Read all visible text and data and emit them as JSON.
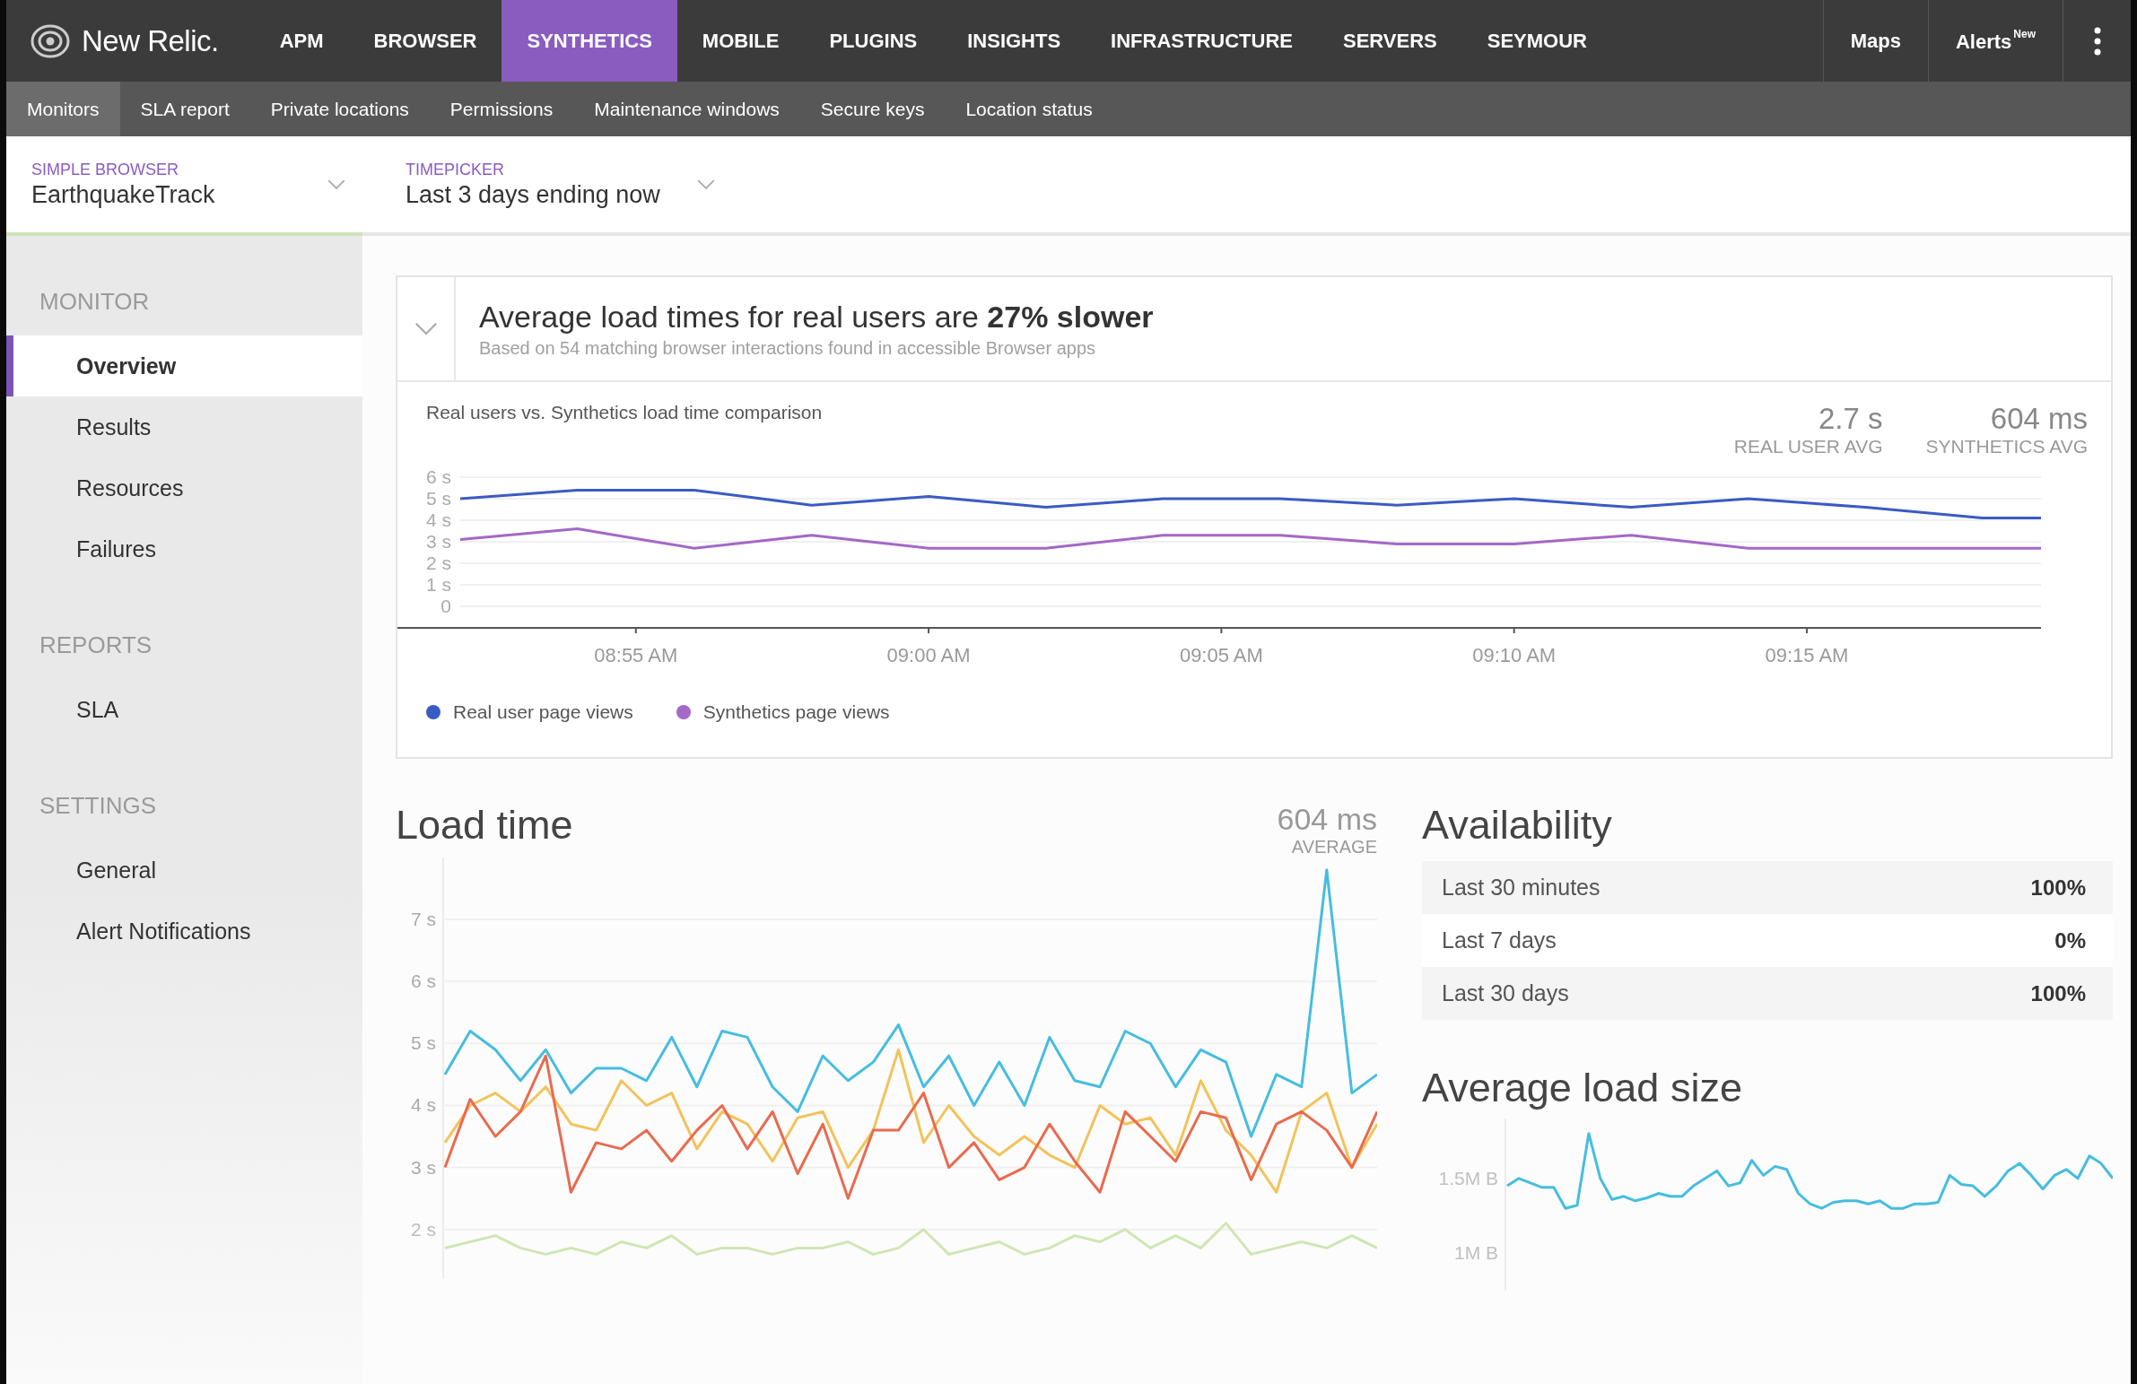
{
  "brand": "New Relic.",
  "nav": [
    {
      "label": "APM",
      "selected": false
    },
    {
      "label": "BROWSER",
      "selected": false
    },
    {
      "label": "SYNTHETICS",
      "selected": true
    },
    {
      "label": "MOBILE",
      "selected": false
    },
    {
      "label": "PLUGINS",
      "selected": false
    },
    {
      "label": "INSIGHTS",
      "selected": false
    },
    {
      "label": "INFRASTRUCTURE",
      "selected": false
    },
    {
      "label": "SERVERS",
      "selected": false
    },
    {
      "label": "SEYMOUR",
      "selected": false
    }
  ],
  "nav_right": [
    {
      "label": "Maps"
    },
    {
      "label": "Alerts",
      "badge": "New"
    }
  ],
  "subnav": [
    {
      "label": "Monitors",
      "selected": true
    },
    {
      "label": "SLA report",
      "selected": false
    },
    {
      "label": "Private locations",
      "selected": false
    },
    {
      "label": "Permissions",
      "selected": false
    },
    {
      "label": "Maintenance windows",
      "selected": false
    },
    {
      "label": "Secure keys",
      "selected": false
    },
    {
      "label": "Location status",
      "selected": false
    }
  ],
  "monitor_picker": {
    "label": "SIMPLE BROWSER",
    "value": "EarthquakeTrack"
  },
  "timepicker": {
    "label": "TIMEPICKER",
    "value": "Last 3 days ending now"
  },
  "sidebar": [
    {
      "heading": "MONITOR",
      "items": [
        {
          "label": "Overview",
          "selected": true
        },
        {
          "label": "Results",
          "selected": false
        },
        {
          "label": "Resources",
          "selected": false
        },
        {
          "label": "Failures",
          "selected": false
        }
      ]
    },
    {
      "heading": "REPORTS",
      "items": [
        {
          "label": "SLA",
          "selected": false
        }
      ]
    },
    {
      "heading": "SETTINGS",
      "items": [
        {
          "label": "General",
          "selected": false
        },
        {
          "label": "Alert Notifications",
          "selected": false
        }
      ]
    }
  ],
  "insight": {
    "headline": "Average load times for real users are **27% slower**",
    "subtext": "Based on 54 matching browser interactions found in accessible Browser apps"
  },
  "comparison": {
    "title": "Real users vs. Synthetics load time comparison",
    "stats": [
      {
        "value": "2.7 s",
        "label": "REAL USER AVG"
      },
      {
        "value": "604 ms",
        "label": "SYNTHETICS AVG"
      }
    ],
    "chart_data": {
      "type": "line",
      "grid": true,
      "ylim": [
        0,
        6
      ],
      "categories": [
        null,
        null,
        null,
        "08:55 AM",
        null,
        null,
        null,
        null,
        "09:00 AM",
        null,
        null,
        null,
        null,
        "09:05 AM",
        null,
        null,
        null,
        null,
        "09:10 AM",
        null,
        null,
        null,
        null,
        "09:15 AM",
        null,
        null,
        null,
        null
      ],
      "yticks": [
        {
          "value": 0,
          "label": "0"
        },
        {
          "value": 1,
          "label": "1 s"
        },
        {
          "value": 2,
          "label": "2 s"
        },
        {
          "value": 3,
          "label": "3 s"
        },
        {
          "value": 4,
          "label": "4 s"
        },
        {
          "value": 5,
          "label": "5 s"
        },
        {
          "value": 6,
          "label": "6 s"
        }
      ],
      "series": [
        {
          "name": "Real user page views",
          "color": "#3b5bc4",
          "values": [
            5.0,
            5.2,
            5.4,
            5.4,
            5.4,
            5.05,
            4.7,
            4.9,
            5.1,
            4.85,
            4.6,
            4.8,
            5.0,
            5.0,
            5.0,
            4.85,
            4.7,
            4.85,
            5.0,
            4.8,
            4.6,
            4.8,
            5.0,
            4.8,
            4.6,
            4.35,
            4.1,
            4.1
          ]
        },
        {
          "name": "Synthetics page views",
          "color": "#a468c6",
          "values": [
            3.1,
            3.35,
            3.6,
            3.15,
            2.7,
            3.0,
            3.3,
            3.0,
            2.7,
            2.7,
            2.7,
            3.0,
            3.3,
            3.3,
            3.3,
            3.1,
            2.9,
            2.9,
            2.9,
            3.1,
            3.3,
            3.0,
            2.7,
            2.7,
            2.7,
            2.7,
            2.7,
            2.7
          ]
        }
      ]
    }
  },
  "load_time": {
    "title": "Load time",
    "stat": {
      "value": "604 ms",
      "label": "AVERAGE"
    },
    "chart_data": {
      "type": "line",
      "grid": true,
      "ylim": [
        1.2,
        8
      ],
      "yticks": [
        {
          "value": 2,
          "label": "2 s"
        },
        {
          "value": 3,
          "label": "3 s"
        },
        {
          "value": 4,
          "label": "4 s"
        },
        {
          "value": 5,
          "label": "5 s"
        },
        {
          "value": 6,
          "label": "6 s"
        },
        {
          "value": 7,
          "label": "7 s"
        }
      ],
      "series": [
        {
          "color": "#45bde0",
          "values": [
            4.5,
            5.2,
            4.9,
            4.4,
            4.9,
            4.2,
            4.6,
            4.6,
            4.4,
            5.1,
            4.3,
            5.2,
            5.1,
            4.3,
            3.9,
            4.8,
            4.4,
            4.7,
            5.3,
            4.3,
            4.8,
            4.0,
            4.7,
            4.0,
            5.1,
            4.4,
            4.3,
            5.2,
            5.0,
            4.3,
            4.9,
            4.7,
            3.5,
            4.5,
            4.3,
            7.8,
            4.2,
            4.5
          ]
        },
        {
          "color": "#f2c35a",
          "values": [
            3.4,
            4.0,
            4.2,
            3.9,
            4.3,
            3.7,
            3.6,
            4.4,
            4.0,
            4.2,
            3.3,
            3.9,
            3.7,
            3.1,
            3.8,
            3.9,
            3.0,
            3.6,
            4.9,
            3.4,
            4.0,
            3.5,
            3.2,
            3.5,
            3.2,
            3.0,
            4.0,
            3.7,
            3.8,
            3.2,
            4.4,
            3.6,
            3.2,
            2.6,
            3.9,
            4.2,
            3.0,
            3.7
          ]
        },
        {
          "color": "#ea6a4e",
          "values": [
            3.0,
            4.1,
            3.5,
            3.9,
            4.8,
            2.6,
            3.4,
            3.3,
            3.6,
            3.1,
            3.6,
            4.0,
            3.3,
            3.9,
            2.9,
            3.7,
            2.5,
            3.6,
            3.6,
            4.2,
            3.0,
            3.4,
            2.8,
            3.0,
            3.7,
            3.1,
            2.6,
            3.9,
            3.5,
            3.1,
            3.9,
            3.8,
            2.8,
            3.7,
            3.9,
            3.6,
            3.0,
            3.9
          ]
        },
        {
          "color": "#cfe6b4",
          "values": [
            1.7,
            1.8,
            1.9,
            1.7,
            1.6,
            1.7,
            1.6,
            1.8,
            1.7,
            1.9,
            1.6,
            1.7,
            1.7,
            1.6,
            1.7,
            1.7,
            1.8,
            1.6,
            1.7,
            2.0,
            1.6,
            1.7,
            1.8,
            1.6,
            1.7,
            1.9,
            1.8,
            2.0,
            1.7,
            1.9,
            1.7,
            2.1,
            1.6,
            1.7,
            1.8,
            1.7,
            1.9,
            1.7
          ]
        }
      ]
    }
  },
  "availability": {
    "title": "Availability",
    "rows": [
      {
        "period": "Last 30 minutes",
        "value": "100%"
      },
      {
        "period": "Last 7 days",
        "value": "0%"
      },
      {
        "period": "Last 30 days",
        "value": "100%"
      }
    ]
  },
  "load_size": {
    "title": "Average load size",
    "chart_data": {
      "type": "line",
      "ylim": [
        750000,
        1900000
      ],
      "yticks": [
        {
          "value": 1000000,
          "label": "1M B"
        },
        {
          "value": 1500000,
          "label": "1.5M B"
        }
      ],
      "series": [
        {
          "color": "#45bde0",
          "values": [
            1450000,
            1500000,
            1470000,
            1440000,
            1440000,
            1300000,
            1320000,
            1800000,
            1500000,
            1360000,
            1380000,
            1350000,
            1370000,
            1400000,
            1380000,
            1380000,
            1450000,
            1500000,
            1550000,
            1450000,
            1470000,
            1620000,
            1520000,
            1580000,
            1560000,
            1400000,
            1330000,
            1300000,
            1340000,
            1350000,
            1350000,
            1330000,
            1350000,
            1300000,
            1300000,
            1330000,
            1330000,
            1340000,
            1520000,
            1460000,
            1450000,
            1380000,
            1450000,
            1550000,
            1600000,
            1520000,
            1430000,
            1520000,
            1560000,
            1500000,
            1650000,
            1600000,
            1500000
          ]
        }
      ]
    }
  }
}
